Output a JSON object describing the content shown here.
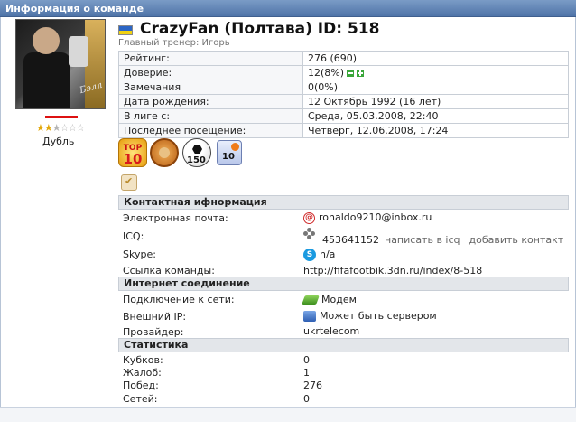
{
  "window": {
    "title": "Информация о команде"
  },
  "profile": {
    "team_title": "CrazyFan (Полтава) ID: 518",
    "coach_label": "Главный тренер: Игорь",
    "photo_signature": "Бэлл",
    "rating_stars": {
      "value": 2.5,
      "max": 6
    },
    "rank_label": "Дубль",
    "flag_colors": [
      "#2c66c5",
      "#f1d210"
    ]
  },
  "info_rows": [
    {
      "label": "Рейтинг:",
      "value": "276 (690)"
    },
    {
      "label": "Доверие:",
      "value": "12(8%)"
    },
    {
      "label": "Замечания",
      "value": "0(0%)"
    },
    {
      "label": "Дата рождения:",
      "value": "12 Октябрь 1992 (16 лет)"
    },
    {
      "label": "В лиге с:",
      "value": "Среда, 05.03.2008, 22:40"
    },
    {
      "label": "Последнее посещение:",
      "value": "Четверг, 12.06.2008, 17:24"
    }
  ],
  "badges": {
    "top": {
      "line1": "TOP",
      "line2": "10"
    },
    "ball_count": "150",
    "mail_count": "10"
  },
  "contacts": {
    "header": "Контактная ифнормация",
    "email_label": "Электронная почта:",
    "email_value": "ronaldo9210@inbox.ru",
    "icq_label": "ICQ:",
    "icq_value": "453641152",
    "icq_write": "написать в icq",
    "icq_add": "добавить контакт",
    "skype_label": "Skype:",
    "skype_value": "n/a",
    "link_label": "Ссылка команды:",
    "link_value": "http://fifafootbik.3dn.ru/index/8-518"
  },
  "internet": {
    "header": "Интернет соединение",
    "connection_label": "Подключение к сети:",
    "connection_value": "Модем",
    "ip_label": "Внешний IP:",
    "ip_value": "Может быть сервером",
    "provider_label": "Провайдер:",
    "provider_value": "ukrtelecom"
  },
  "stats": {
    "header": "Статистика",
    "rows": [
      {
        "label": "Кубков:",
        "value": "0"
      },
      {
        "label": "Жалоб:",
        "value": "1"
      },
      {
        "label": "Побед:",
        "value": "276"
      },
      {
        "label": "Сетей:",
        "value": "0"
      }
    ]
  }
}
